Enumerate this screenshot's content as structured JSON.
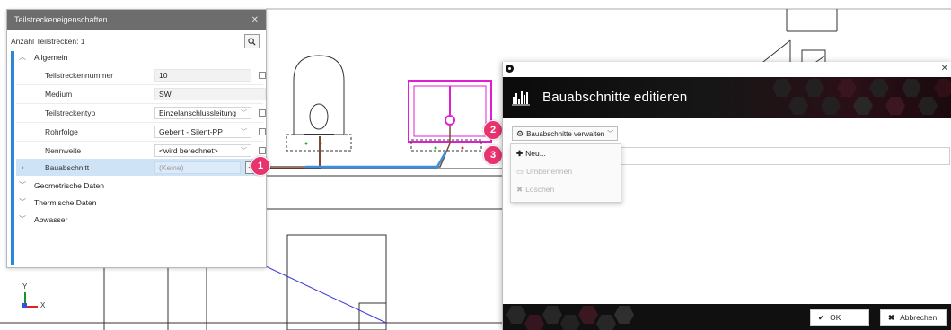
{
  "panel": {
    "title": "Teilstreckeneigenschaften",
    "count_label": "Anzahl Teilstrecken: 1",
    "groups": {
      "allgemein": "Allgemein",
      "geometrie": "Geometrische Daten",
      "thermisch": "Thermische Daten",
      "abwasser": "Abwasser"
    },
    "rows": [
      {
        "label": "Teilstreckennummer",
        "value": "10"
      },
      {
        "label": "Medium",
        "value": "SW"
      },
      {
        "label": "Teilstreckentyp",
        "value": "Einzelanschlussleitung"
      },
      {
        "label": "Rohrfolge",
        "value": "Geberit - Silent-PP"
      },
      {
        "label": "Nennweite",
        "value": "<wird berechnet>"
      },
      {
        "label": "Bauabschnitt",
        "value": "(Keine)"
      }
    ],
    "dots_label": "..."
  },
  "badges": [
    "1",
    "2",
    "3"
  ],
  "dialog": {
    "title": "Bauabschnitte editieren",
    "manage_button": "Bauabschnitte verwalten",
    "menu": {
      "new": "Neu...",
      "rename": "Umbenennen",
      "delete": "Löschen"
    },
    "ok": "OK",
    "cancel": "Abbrechen"
  },
  "axis": {
    "y": "Y",
    "x": "X"
  },
  "colors": {
    "accent": "#2b88d8",
    "badge": "#e8336f",
    "magenta": "#e020d0",
    "pipe_blue": "#3a8fe0",
    "pipe_brown": "#7a4a35"
  }
}
